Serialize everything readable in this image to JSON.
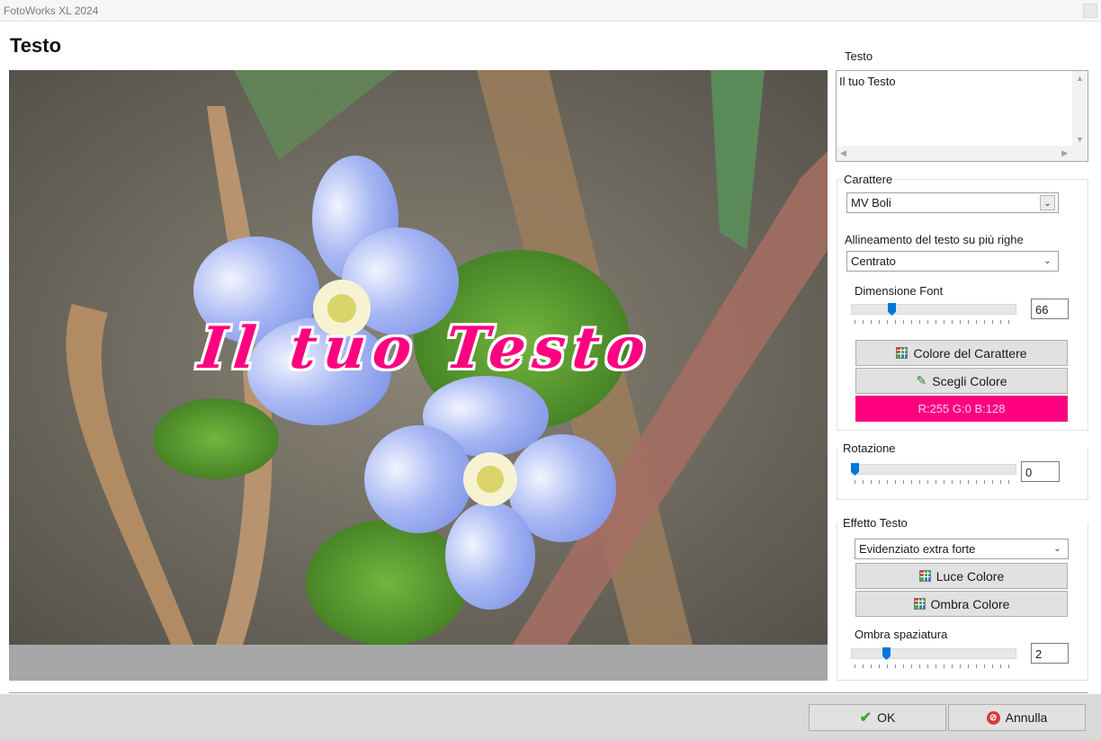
{
  "window": {
    "app_title": "FotoWorks XL 2024"
  },
  "page": {
    "title": "Testo"
  },
  "preview": {
    "overlay_text": "Il tuo Testo"
  },
  "panel": {
    "text_label": "Testo",
    "text_value": "Il tuo Testo",
    "font_group_label": "Carattere",
    "font_value": "MV Boli",
    "align_label": "Allineamento del testo su più righe",
    "align_value": "Centrato",
    "font_size_label": "Dimensione Font",
    "font_size_value": "66",
    "font_size_level": 0.2,
    "font_color_button": "Colore del Carattere",
    "pick_color_button": "Scegli Colore",
    "color_readout": "R:255  G:0  B:128",
    "rotation_label": "Rotazione",
    "rotation_value": "0",
    "rotation_level": 0.0,
    "effect_label": "Effetto Testo",
    "effect_value": "Evidenziato extra forte",
    "light_color_button": "Luce Colore",
    "shadow_color_button": "Ombra Colore",
    "shadow_spacing_label": "Ombra spaziatura",
    "shadow_spacing_value": "2",
    "shadow_spacing_level": 0.2
  },
  "footer": {
    "ok_label": "OK",
    "cancel_label": "Annulla"
  },
  "colors": {
    "text_color": "#ff0080",
    "accent": "#0078d7"
  },
  "icons": [
    "color-grid-icon",
    "eyedropper-icon",
    "check-icon",
    "cancel-icon"
  ]
}
